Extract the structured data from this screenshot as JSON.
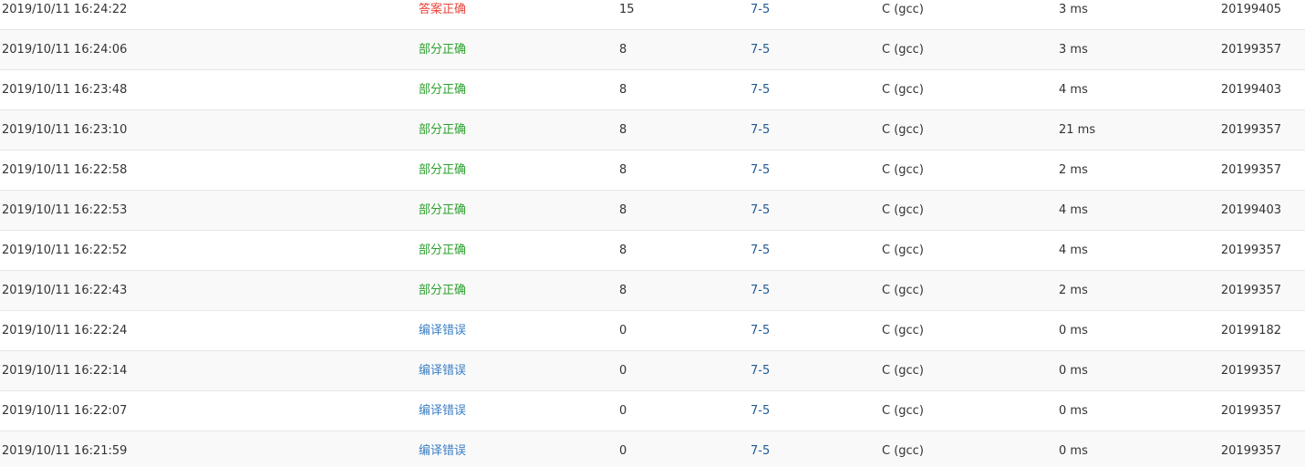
{
  "colors": {
    "accepted": "#e8443a",
    "partial": "#2ca02c",
    "compile_error": "#3b7fc4",
    "link": "#1e5a96",
    "text": "#333333"
  },
  "submissions": [
    {
      "time": "2019/10/11 16:24:22",
      "status": "答案正确",
      "status_kind": "accepted",
      "score": "15",
      "problem": "7-5",
      "language": "C (gcc)",
      "runtime": "3 ms",
      "user": "20199405"
    },
    {
      "time": "2019/10/11 16:24:06",
      "status": "部分正确",
      "status_kind": "partial",
      "score": "8",
      "problem": "7-5",
      "language": "C (gcc)",
      "runtime": "3 ms",
      "user": "20199357"
    },
    {
      "time": "2019/10/11 16:23:48",
      "status": "部分正确",
      "status_kind": "partial",
      "score": "8",
      "problem": "7-5",
      "language": "C (gcc)",
      "runtime": "4 ms",
      "user": "20199403"
    },
    {
      "time": "2019/10/11 16:23:10",
      "status": "部分正确",
      "status_kind": "partial",
      "score": "8",
      "problem": "7-5",
      "language": "C (gcc)",
      "runtime": "21 ms",
      "user": "20199357"
    },
    {
      "time": "2019/10/11 16:22:58",
      "status": "部分正确",
      "status_kind": "partial",
      "score": "8",
      "problem": "7-5",
      "language": "C (gcc)",
      "runtime": "2 ms",
      "user": "20199357"
    },
    {
      "time": "2019/10/11 16:22:53",
      "status": "部分正确",
      "status_kind": "partial",
      "score": "8",
      "problem": "7-5",
      "language": "C (gcc)",
      "runtime": "4 ms",
      "user": "20199403"
    },
    {
      "time": "2019/10/11 16:22:52",
      "status": "部分正确",
      "status_kind": "partial",
      "score": "8",
      "problem": "7-5",
      "language": "C (gcc)",
      "runtime": "4 ms",
      "user": "20199357"
    },
    {
      "time": "2019/10/11 16:22:43",
      "status": "部分正确",
      "status_kind": "partial",
      "score": "8",
      "problem": "7-5",
      "language": "C (gcc)",
      "runtime": "2 ms",
      "user": "20199357"
    },
    {
      "time": "2019/10/11 16:22:24",
      "status": "编译错误",
      "status_kind": "compile",
      "score": "0",
      "problem": "7-5",
      "language": "C (gcc)",
      "runtime": "0 ms",
      "user": "20199182"
    },
    {
      "time": "2019/10/11 16:22:14",
      "status": "编译错误",
      "status_kind": "compile",
      "score": "0",
      "problem": "7-5",
      "language": "C (gcc)",
      "runtime": "0 ms",
      "user": "20199357"
    },
    {
      "time": "2019/10/11 16:22:07",
      "status": "编译错误",
      "status_kind": "compile",
      "score": "0",
      "problem": "7-5",
      "language": "C (gcc)",
      "runtime": "0 ms",
      "user": "20199357"
    },
    {
      "time": "2019/10/11 16:21:59",
      "status": "编译错误",
      "status_kind": "compile",
      "score": "0",
      "problem": "7-5",
      "language": "C (gcc)",
      "runtime": "0 ms",
      "user": "20199357"
    }
  ]
}
